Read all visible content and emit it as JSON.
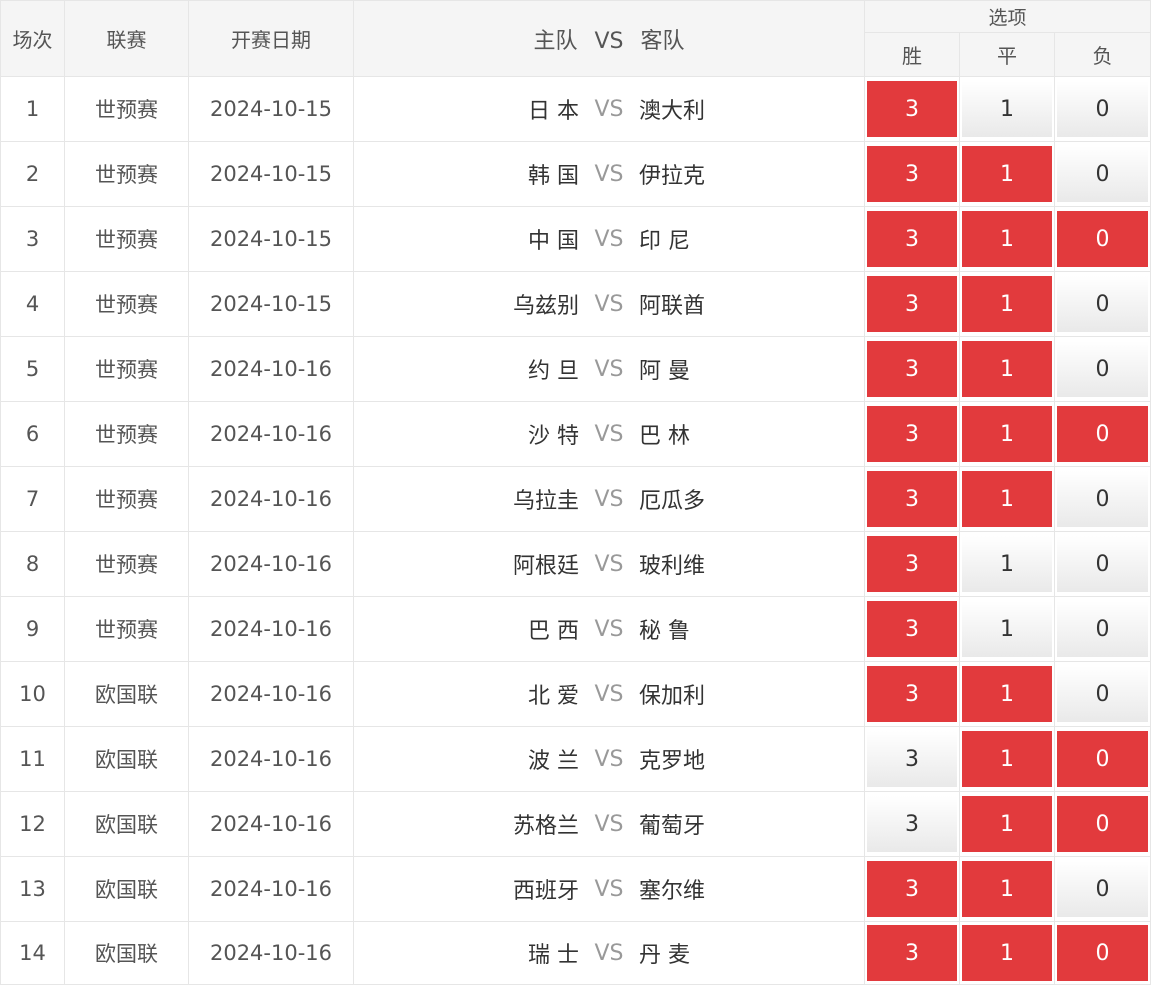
{
  "header": {
    "col_num": "场次",
    "col_league": "联赛",
    "col_date": "开赛日期",
    "col_match_home": "主队",
    "col_match_vs": "VS",
    "col_match_away": "客队",
    "options_group": "选项",
    "opt_win": "胜",
    "opt_draw": "平",
    "opt_lose": "负"
  },
  "colors": {
    "selected_bg": "#e23a3d",
    "unselected_text": "#333333",
    "vs_text": "#999999"
  },
  "rows": [
    {
      "num": "1",
      "league": "世预赛",
      "date": "2024-10-15",
      "home": "日 本",
      "vs": "VS",
      "away": "澳大利",
      "win": "3",
      "draw": "1",
      "lose": "0",
      "win_selected": true,
      "draw_selected": false,
      "lose_selected": false
    },
    {
      "num": "2",
      "league": "世预赛",
      "date": "2024-10-15",
      "home": "韩 国",
      "vs": "VS",
      "away": "伊拉克",
      "win": "3",
      "draw": "1",
      "lose": "0",
      "win_selected": true,
      "draw_selected": true,
      "lose_selected": false
    },
    {
      "num": "3",
      "league": "世预赛",
      "date": "2024-10-15",
      "home": "中 国",
      "vs": "VS",
      "away": "印 尼",
      "win": "3",
      "draw": "1",
      "lose": "0",
      "win_selected": true,
      "draw_selected": true,
      "lose_selected": true
    },
    {
      "num": "4",
      "league": "世预赛",
      "date": "2024-10-15",
      "home": "乌兹别",
      "vs": "VS",
      "away": "阿联酋",
      "win": "3",
      "draw": "1",
      "lose": "0",
      "win_selected": true,
      "draw_selected": true,
      "lose_selected": false
    },
    {
      "num": "5",
      "league": "世预赛",
      "date": "2024-10-16",
      "home": "约 旦",
      "vs": "VS",
      "away": "阿 曼",
      "win": "3",
      "draw": "1",
      "lose": "0",
      "win_selected": true,
      "draw_selected": true,
      "lose_selected": false
    },
    {
      "num": "6",
      "league": "世预赛",
      "date": "2024-10-16",
      "home": "沙 特",
      "vs": "VS",
      "away": "巴 林",
      "win": "3",
      "draw": "1",
      "lose": "0",
      "win_selected": true,
      "draw_selected": true,
      "lose_selected": true
    },
    {
      "num": "7",
      "league": "世预赛",
      "date": "2024-10-16",
      "home": "乌拉圭",
      "vs": "VS",
      "away": "厄瓜多",
      "win": "3",
      "draw": "1",
      "lose": "0",
      "win_selected": true,
      "draw_selected": true,
      "lose_selected": false
    },
    {
      "num": "8",
      "league": "世预赛",
      "date": "2024-10-16",
      "home": "阿根廷",
      "vs": "VS",
      "away": "玻利维",
      "win": "3",
      "draw": "1",
      "lose": "0",
      "win_selected": true,
      "draw_selected": false,
      "lose_selected": false
    },
    {
      "num": "9",
      "league": "世预赛",
      "date": "2024-10-16",
      "home": "巴 西",
      "vs": "VS",
      "away": "秘 鲁",
      "win": "3",
      "draw": "1",
      "lose": "0",
      "win_selected": true,
      "draw_selected": false,
      "lose_selected": false
    },
    {
      "num": "10",
      "league": "欧国联",
      "date": "2024-10-16",
      "home": "北 爱",
      "vs": "VS",
      "away": "保加利",
      "win": "3",
      "draw": "1",
      "lose": "0",
      "win_selected": true,
      "draw_selected": true,
      "lose_selected": false
    },
    {
      "num": "11",
      "league": "欧国联",
      "date": "2024-10-16",
      "home": "波 兰",
      "vs": "VS",
      "away": "克罗地",
      "win": "3",
      "draw": "1",
      "lose": "0",
      "win_selected": false,
      "draw_selected": true,
      "lose_selected": true
    },
    {
      "num": "12",
      "league": "欧国联",
      "date": "2024-10-16",
      "home": "苏格兰",
      "vs": "VS",
      "away": "葡萄牙",
      "win": "3",
      "draw": "1",
      "lose": "0",
      "win_selected": false,
      "draw_selected": true,
      "lose_selected": true
    },
    {
      "num": "13",
      "league": "欧国联",
      "date": "2024-10-16",
      "home": "西班牙",
      "vs": "VS",
      "away": "塞尔维",
      "win": "3",
      "draw": "1",
      "lose": "0",
      "win_selected": true,
      "draw_selected": true,
      "lose_selected": false
    },
    {
      "num": "14",
      "league": "欧国联",
      "date": "2024-10-16",
      "home": "瑞 士",
      "vs": "VS",
      "away": "丹 麦",
      "win": "3",
      "draw": "1",
      "lose": "0",
      "win_selected": true,
      "draw_selected": true,
      "lose_selected": true
    }
  ]
}
